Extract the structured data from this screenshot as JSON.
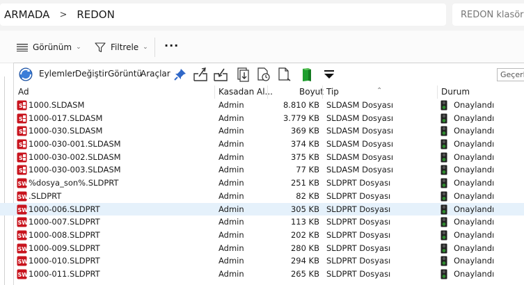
{
  "address": {
    "crumbs": [
      "ARMADA",
      "REDON"
    ],
    "separator": ">",
    "search_placeholder": "REDON klasörü"
  },
  "command_bar": {
    "view_label": "Görünüm",
    "filter_label": "Filtrele",
    "more_label": "···"
  },
  "pdm_toolbar": {
    "menus": [
      "Eylemler",
      "Değiştir",
      "Görüntü",
      "Araçlar"
    ],
    "right_input_value": "Geçerli"
  },
  "columns": {
    "name": "Ad",
    "checked_out_by": "Kasadan Al...",
    "size": "Boyut",
    "type": "Tip",
    "state": "Durum"
  },
  "colors": {
    "sw_red": "#c8141e",
    "selected_row": "#e5f1fb",
    "state_green": "#2e8b2e"
  },
  "files": [
    {
      "name": "1000.SLDASM",
      "user": "Admin",
      "size": "8.810 KB",
      "type": "SLDASM Dosyası",
      "state": "Onaylandı",
      "kind": "asm"
    },
    {
      "name": "1000-017.SLDASM",
      "user": "Admin",
      "size": "3.779 KB",
      "type": "SLDASM Dosyası",
      "state": "Onaylandı",
      "kind": "asm"
    },
    {
      "name": "1000-030.SLDASM",
      "user": "Admin",
      "size": "369 KB",
      "type": "SLDASM Dosyası",
      "state": "Onaylandı",
      "kind": "asm"
    },
    {
      "name": "1000-030-001.SLDASM",
      "user": "Admin",
      "size": "374 KB",
      "type": "SLDASM Dosyası",
      "state": "Onaylandı",
      "kind": "asm"
    },
    {
      "name": "1000-030-002.SLDASM",
      "user": "Admin",
      "size": "375 KB",
      "type": "SLDASM Dosyası",
      "state": "Onaylandı",
      "kind": "asm"
    },
    {
      "name": "1000-030-003.SLDASM",
      "user": "Admin",
      "size": "77 KB",
      "type": "SLDASM Dosyası",
      "state": "Onaylandı",
      "kind": "asm"
    },
    {
      "name": "%dosya_son%.SLDPRT",
      "user": "Admin",
      "size": "251 KB",
      "type": "SLDPRT Dosyası",
      "state": "Onaylandı",
      "kind": "prt"
    },
    {
      "name": ".SLDPRT",
      "user": "Admin",
      "size": "82 KB",
      "type": "SLDPRT Dosyası",
      "state": "Onaylandı",
      "kind": "prt"
    },
    {
      "name": "1000-006.SLDPRT",
      "user": "Admin",
      "size": "305 KB",
      "type": "SLDPRT Dosyası",
      "state": "Onaylandı",
      "kind": "prt",
      "selected": true
    },
    {
      "name": "1000-007.SLDPRT",
      "user": "Admin",
      "size": "113 KB",
      "type": "SLDPRT Dosyası",
      "state": "Onaylandı",
      "kind": "prt"
    },
    {
      "name": "1000-008.SLDPRT",
      "user": "Admin",
      "size": "202 KB",
      "type": "SLDPRT Dosyası",
      "state": "Onaylandı",
      "kind": "prt"
    },
    {
      "name": "1000-009.SLDPRT",
      "user": "Admin",
      "size": "280 KB",
      "type": "SLDPRT Dosyası",
      "state": "Onaylandı",
      "kind": "prt"
    },
    {
      "name": "1000-010.SLDPRT",
      "user": "Admin",
      "size": "294 KB",
      "type": "SLDPRT Dosyası",
      "state": "Onaylandı",
      "kind": "prt"
    },
    {
      "name": "1000-011.SLDPRT",
      "user": "Admin",
      "size": "265 KB",
      "type": "SLDPRT Dosyası",
      "state": "Onaylandı",
      "kind": "prt"
    }
  ]
}
